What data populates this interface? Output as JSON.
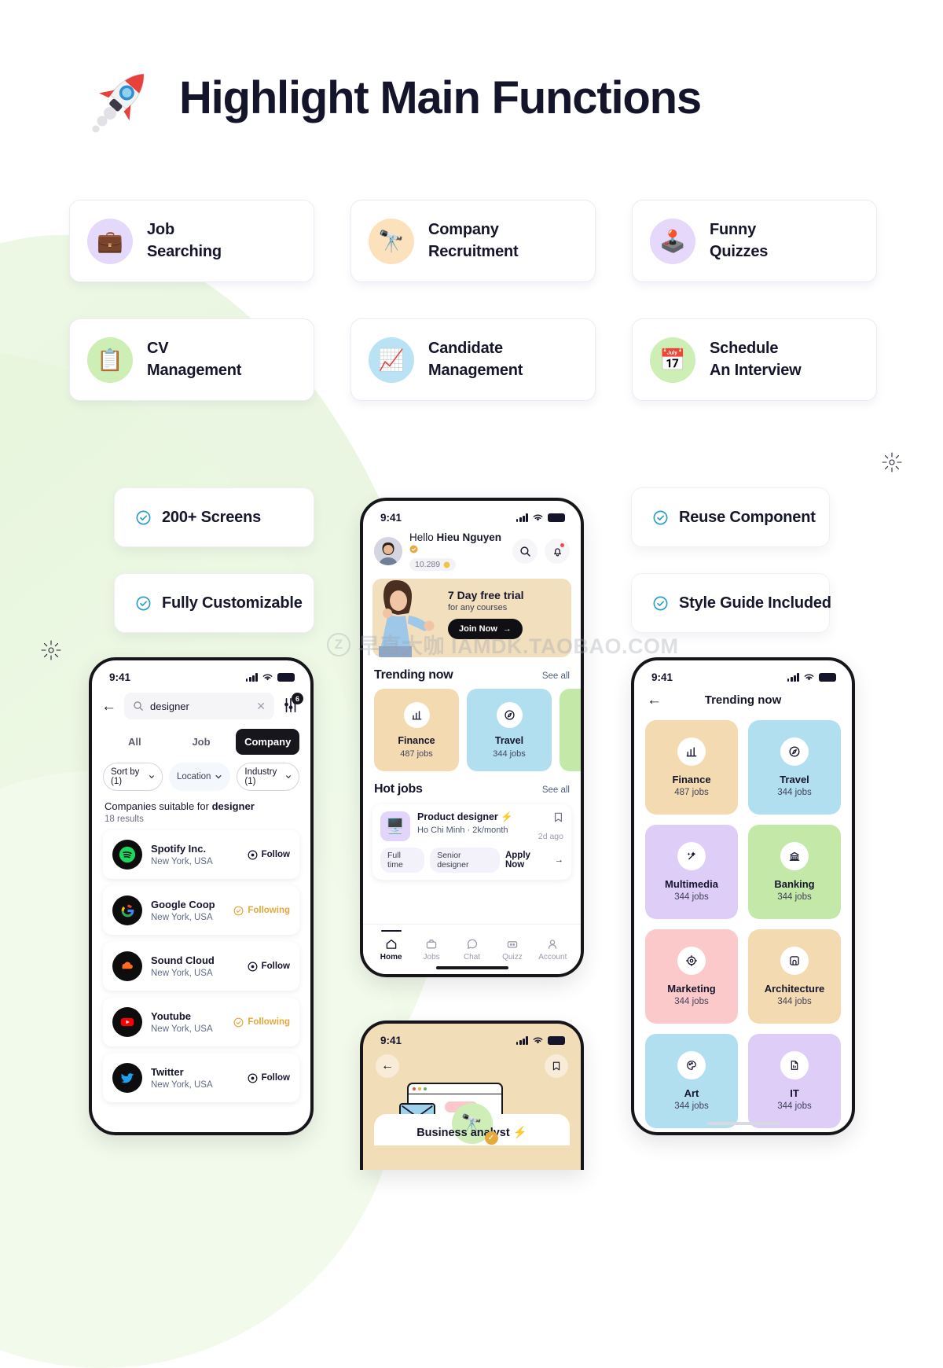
{
  "header": {
    "title": "Highlight Main Functions",
    "icon": "rocket-icon"
  },
  "features": [
    {
      "label_line1": "Job",
      "label_line2": "Searching",
      "emoji": "💼",
      "bubble_color": "#e4d9fb",
      "icon_name": "briefcase-icon"
    },
    {
      "label_line1": "Company",
      "label_line2": "Recruitment",
      "emoji": "🔭",
      "bubble_color": "#fbe2bd",
      "icon_name": "binoculars-icon"
    },
    {
      "label_line1": "Funny",
      "label_line2": "Quizzes",
      "emoji": "🕹️",
      "bubble_color": "#e6d8fb",
      "icon_name": "joystick-icon"
    },
    {
      "label_line1": "CV",
      "label_line2": "Management",
      "emoji": "📋",
      "bubble_color": "#cdeeb4",
      "icon_name": "clipboard-icon"
    },
    {
      "label_line1": "Candidate",
      "label_line2": "Management",
      "emoji": "📈",
      "bubble_color": "#b9e3f4",
      "icon_name": "chart-increasing-icon"
    },
    {
      "label_line1": "Schedule",
      "label_line2": "An Interview",
      "emoji": "📅",
      "bubble_color": "#cdeeb4",
      "icon_name": "calendar-icon"
    }
  ],
  "badges": {
    "screens": "200+ Screens",
    "customizable": "Fully Customizable",
    "reuse": "Reuse Component",
    "style_guide": "Style Guide Included",
    "check_color": "#2d9ec4"
  },
  "phone_left": {
    "status_time": "9:41",
    "search_value": "designer",
    "filter_badge": "6",
    "tabs": [
      {
        "label": "All",
        "active": false
      },
      {
        "label": "Job",
        "active": false
      },
      {
        "label": "Company",
        "active": true
      }
    ],
    "chips": [
      {
        "label": "Sort by (1)",
        "style": "outline"
      },
      {
        "label": "Location",
        "style": "plain"
      },
      {
        "label": "Industry (1)",
        "style": "outline"
      }
    ],
    "results_prefix": "Companies suitable for ",
    "results_query": "designer",
    "results_count": "18 results",
    "companies": [
      {
        "name": "Spotify Inc.",
        "location": "New York, USA",
        "action": "Follow",
        "following": false,
        "logo": "spotify-logo",
        "logo_color": "#1ed760"
      },
      {
        "name": "Google Coop",
        "location": "New York, USA",
        "action": "Following",
        "following": true,
        "logo": "google-logo",
        "logo_color": "#4285f4"
      },
      {
        "name": "Sound Cloud",
        "location": "New York, USA",
        "action": "Follow",
        "following": false,
        "logo": "soundcloud-logo",
        "logo_color": "#ff5500"
      },
      {
        "name": "Youtube",
        "location": "New York, USA",
        "action": "Following",
        "following": true,
        "logo": "youtube-logo",
        "logo_color": "#ff0000"
      },
      {
        "name": "Twitter",
        "location": "New York, USA",
        "action": "Follow",
        "following": false,
        "logo": "twitter-logo",
        "logo_color": "#1da1f2"
      }
    ]
  },
  "phone_center": {
    "status_time": "9:41",
    "greeting_prefix": "Hello ",
    "user_name": "Hieu Nguyen",
    "coins": "10.289",
    "banner": {
      "title": "7 Day free trial",
      "subtitle": "for any courses",
      "cta": "Join Now"
    },
    "trending": {
      "heading": "Trending now",
      "see_all": "See all",
      "cards": [
        {
          "name": "Finance",
          "jobs": "487 jobs",
          "color": "#f3dab0",
          "icon": "bar-chart-icon"
        },
        {
          "name": "Travel",
          "jobs": "344 jobs",
          "color": "#b2dff0",
          "icon": "compass-icon"
        },
        {
          "name": "",
          "jobs": "",
          "color": "#c4e8a8",
          "icon": ""
        }
      ]
    },
    "hot_jobs": {
      "heading": "Hot jobs",
      "see_all": "See all",
      "job": {
        "title": "Product designer",
        "subtitle": "Ho Chi Minh · 2k/month",
        "posted": "2d ago",
        "tags": [
          "Full time",
          "Senior designer"
        ],
        "apply": "Apply Now",
        "thumb_emoji": "🖥️"
      }
    },
    "tabbar": [
      {
        "label": "Home",
        "icon": "home-icon",
        "active": true
      },
      {
        "label": "Jobs",
        "icon": "briefcase-icon",
        "active": false
      },
      {
        "label": "Chat",
        "icon": "chat-icon",
        "active": false
      },
      {
        "label": "Quizz",
        "icon": "quiz-icon",
        "active": false
      },
      {
        "label": "Account",
        "icon": "person-icon",
        "active": false
      }
    ]
  },
  "phone_right": {
    "status_time": "9:41",
    "title": "Trending now",
    "categories": [
      {
        "name": "Finance",
        "jobs": "487 jobs",
        "color": "#f3dab0",
        "icon": "bar-chart-icon"
      },
      {
        "name": "Travel",
        "jobs": "344 jobs",
        "color": "#b2dff0",
        "icon": "compass-icon"
      },
      {
        "name": "Multimedia",
        "jobs": "344 jobs",
        "color": "#ddcdf7",
        "icon": "magic-wand-icon"
      },
      {
        "name": "Banking",
        "jobs": "344 jobs",
        "color": "#c4e8a8",
        "icon": "bank-icon"
      },
      {
        "name": "Marketing",
        "jobs": "344 jobs",
        "color": "#fbc9c9",
        "icon": "target-icon"
      },
      {
        "name": "Architecture",
        "jobs": "344 jobs",
        "color": "#f3dab0",
        "icon": "arch-icon"
      },
      {
        "name": "Art",
        "jobs": "344 jobs",
        "color": "#b2dff0",
        "icon": "palette-icon"
      },
      {
        "name": "IT",
        "jobs": "344 jobs",
        "color": "#ddcdf7",
        "icon": "file-code-icon"
      }
    ]
  },
  "phone_bottom": {
    "status_time": "9:41",
    "job_title": "Business analyst",
    "badge_emoji": "🔭"
  },
  "watermark": {
    "logo": "Z",
    "text": "早直大咖 IAMDK.TAOBAO.COM"
  }
}
